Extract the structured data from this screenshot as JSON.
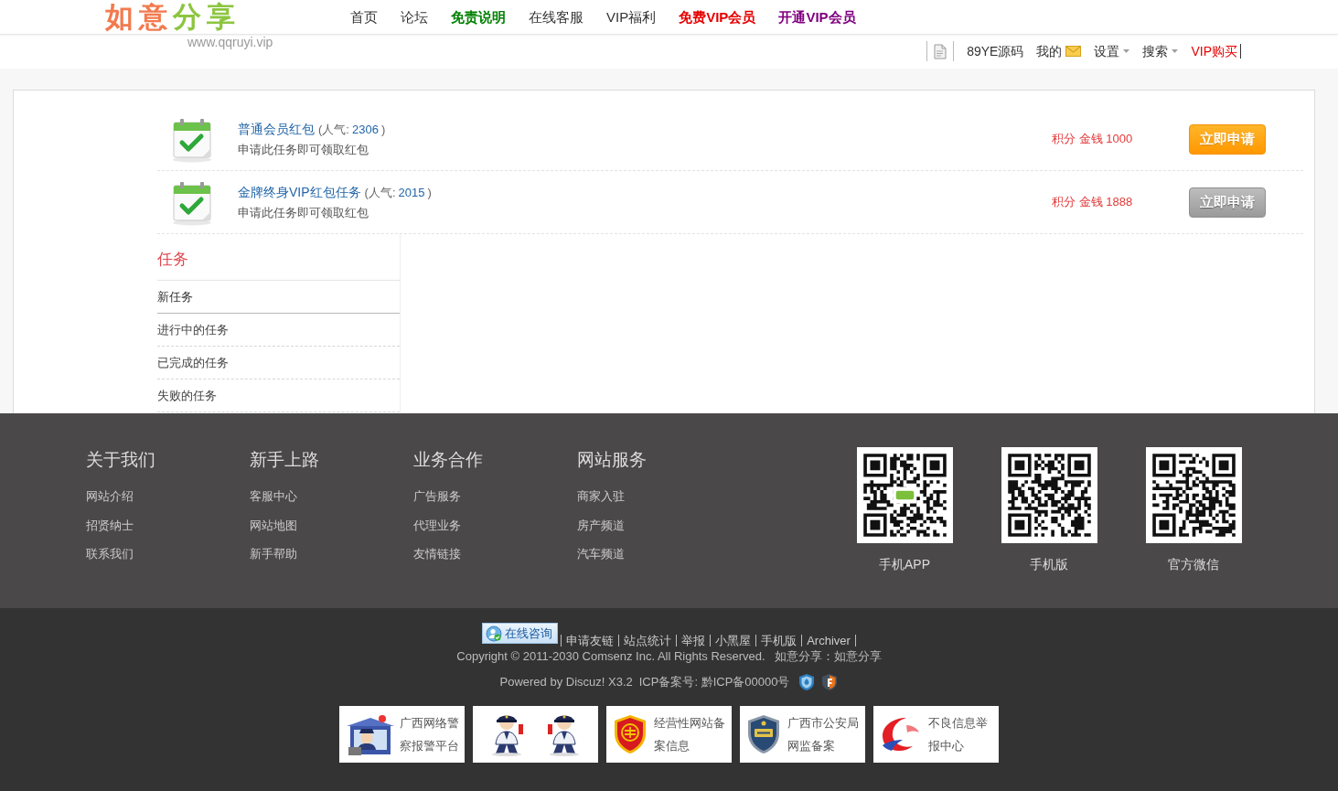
{
  "header": {
    "logo": [
      {
        "text": "如意",
        "color": "#f27a4e"
      },
      {
        "text": "分享",
        "color": "#8cc540"
      }
    ],
    "url": "www.qqruyi.vip",
    "nav": [
      {
        "label": "首页",
        "kind": "plain"
      },
      {
        "label": "论坛",
        "kind": "plain"
      },
      {
        "label": "免责说明",
        "kind": "highlight",
        "color": "#008000"
      },
      {
        "label": "在线客服",
        "kind": "plain"
      },
      {
        "label": "VIP福利",
        "kind": "plain"
      },
      {
        "label": "免费VIP会员",
        "kind": "highlight",
        "color": "#e60000"
      },
      {
        "label": "开通VIP会员",
        "kind": "highlight",
        "color": "#800080"
      }
    ],
    "user_bar": [
      {
        "label": "89YE源码",
        "kind": "link"
      },
      {
        "label": "我的",
        "kind": "mail"
      },
      {
        "label": "设置",
        "kind": "dropdown"
      },
      {
        "label": "搜索",
        "kind": "dropdown"
      },
      {
        "label": "VIP购买",
        "kind": "highlight"
      }
    ]
  },
  "tasks": [
    {
      "title": "普通会员红包",
      "popularity_label": "(人气:",
      "popularity": "2306",
      "popularity_end": ")",
      "description": "申请此任务即可领取红包",
      "reward": "积分 金钱 1000",
      "button": "立即申请",
      "disabled": false
    },
    {
      "title": "金牌终身VIP红包任务",
      "popularity_label": "(人气:",
      "popularity": "2015",
      "popularity_end": ")",
      "description": "申请此任务即可领取红包",
      "reward": "积分 金钱 1888",
      "button": "立即申请",
      "disabled": true
    }
  ],
  "sidebar": {
    "title": "任务",
    "items": [
      {
        "label": "新任务",
        "selected": true
      },
      {
        "label": "进行中的任务",
        "selected": false
      },
      {
        "label": "已完成的任务",
        "selected": false
      },
      {
        "label": "失败的任务",
        "selected": false
      }
    ]
  },
  "footer": {
    "columns": [
      {
        "title": "关于我们",
        "links": [
          "网站介绍",
          "招贤纳士",
          "联系我们"
        ]
      },
      {
        "title": "新手上路",
        "links": [
          "客服中心",
          "网站地图",
          "新手帮助"
        ]
      },
      {
        "title": "业务合作",
        "links": [
          "广告服务",
          "代理业务",
          "友情链接"
        ]
      },
      {
        "title": "网站服务",
        "links": [
          "商家入驻",
          "房产频道",
          "汽车频道"
        ]
      }
    ],
    "qr_codes": [
      {
        "label": "手机APP",
        "kind": "logo"
      },
      {
        "label": "手机版",
        "kind": "plain"
      },
      {
        "label": "官方微信",
        "kind": "plain"
      }
    ],
    "consult_button": "在线咨询",
    "links": [
      "申请友链",
      "站点统计",
      "举报",
      "小黑屋",
      "手机版",
      "Archiver"
    ],
    "copyright": "Copyright © 2011-2030 Comsenz Inc. All Rights Reserved.",
    "site_credit": "如意分享：如意分享",
    "powered_by": "Powered by Discuz! X3.2",
    "icp": "ICP备案号: 黔ICP备00000号",
    "badges": [
      {
        "kind": "police-booth",
        "text": "广西网络警察报警平台"
      },
      {
        "kind": "police-pair"
      },
      {
        "kind": "business-shield",
        "text": "经营性网站备案信息"
      },
      {
        "kind": "police-shield",
        "text": "广西市公安局网监备案"
      },
      {
        "kind": "report",
        "text": "不良信息举报中心"
      }
    ]
  }
}
